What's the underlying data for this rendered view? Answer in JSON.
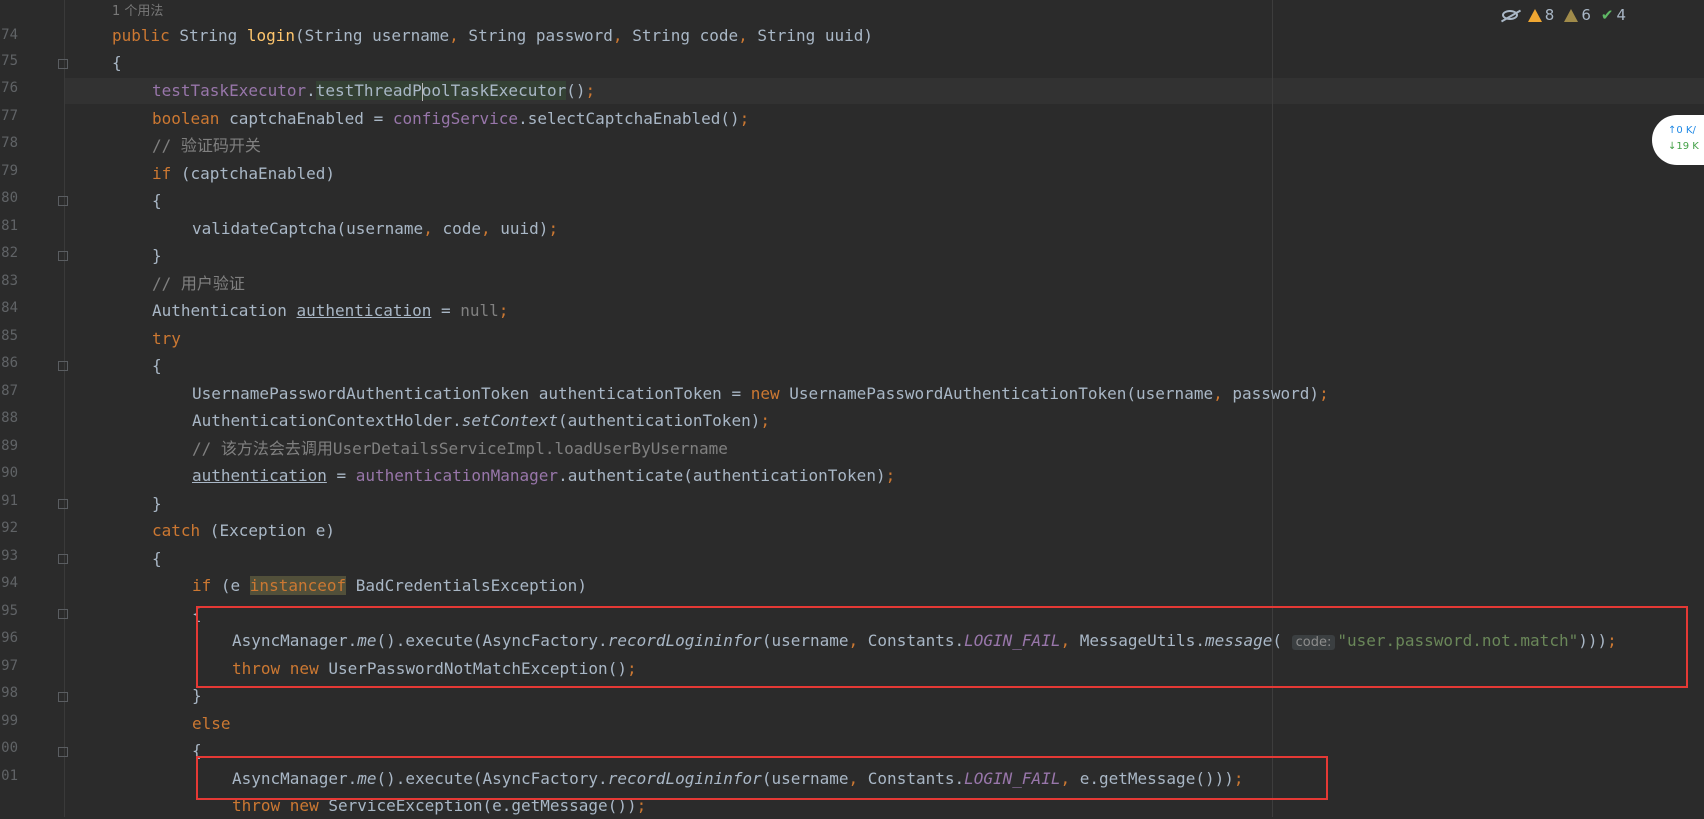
{
  "editor": {
    "usage_hint": "1 个用法",
    "line_numbers": [
      "74",
      "75",
      "76",
      "77",
      "78",
      "79",
      "80",
      "81",
      "82",
      "83",
      "84",
      "85",
      "86",
      "87",
      "88",
      "89",
      "90",
      "91",
      "92",
      "93",
      "94",
      "95",
      "96",
      "97",
      "98",
      "99",
      "00",
      "01"
    ],
    "comments": {
      "captcha": "// 验证码开关",
      "user_auth": "// 用户验证",
      "load_user": "// 该方法会去调用UserDetailsServiceImpl.loadUserByUsername"
    },
    "param_hint": "code:",
    "string_literal": "\"user.password.not.match\""
  },
  "inspections": {
    "warnings": "8",
    "weak_warnings": "6",
    "ok": "4"
  },
  "network": {
    "up": "↑0 K/",
    "down": "↓19 K"
  },
  "colors": {
    "background": "#2b2b2b",
    "keyword": "#cc7832",
    "method": "#ffc66d",
    "field": "#9876aa",
    "string": "#6a8759",
    "highlight_box": "#e53935"
  }
}
